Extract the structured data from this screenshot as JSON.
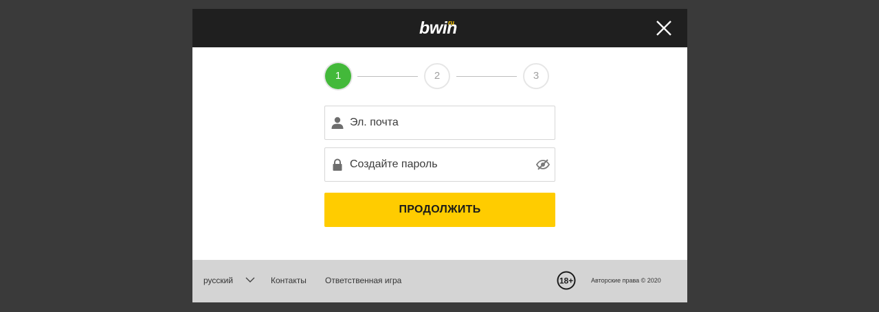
{
  "header": {
    "logo_text": "bwin",
    "logo_suffix": "ru"
  },
  "stepper": {
    "steps": [
      {
        "label": "1",
        "state": "active"
      },
      {
        "label": "2",
        "state": "inactive"
      },
      {
        "label": "3",
        "state": "inactive"
      }
    ],
    "active_color": "#43b93a"
  },
  "form": {
    "email": {
      "placeholder": "Эл. почта",
      "value": "",
      "icon": "user-icon"
    },
    "password": {
      "placeholder": "Создайте пароль",
      "value": "",
      "icon": "lock-icon",
      "toggle_icon": "eye-off-icon"
    },
    "continue_label": "ПРОДОЛЖИТЬ",
    "button_color": "#ffcc00"
  },
  "footer": {
    "language": "русский",
    "contacts": "Контакты",
    "responsible_gaming": "Ответственная игра",
    "age_badge": "18+",
    "copyright": "Авторские права © 2020"
  }
}
